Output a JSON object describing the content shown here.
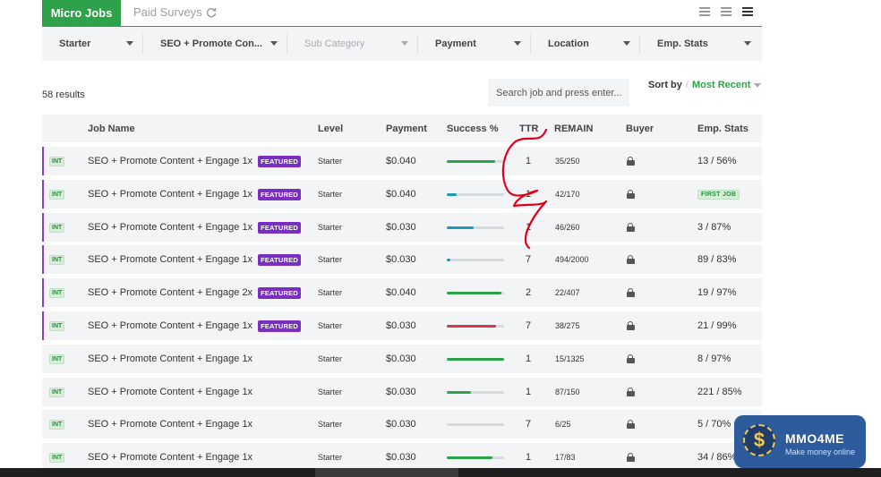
{
  "tabs": {
    "micro_jobs": "Micro Jobs",
    "paid_surveys": "Paid Surveys"
  },
  "filters": [
    {
      "label": "Starter",
      "muted": false
    },
    {
      "label": "SEO + Promote Con...",
      "muted": false
    },
    {
      "label": "Sub Category",
      "muted": true
    },
    {
      "label": "Payment",
      "muted": false
    },
    {
      "label": "Location",
      "muted": false
    },
    {
      "label": "Emp. Stats",
      "muted": false
    }
  ],
  "results_text": "58 results",
  "search": {
    "placeholder": "Search job and press enter..."
  },
  "sort": {
    "label": "Sort by",
    "value": "Most Recent"
  },
  "columns": {
    "job_name": "Job Name",
    "level": "Level",
    "payment": "Payment",
    "success": "Success %",
    "ttr": "TTR",
    "remain": "REMAIN",
    "buyer": "Buyer",
    "emp_stats": "Emp. Stats"
  },
  "tag_int": "INT",
  "tag_featured": "FEATURED",
  "tag_first_job": "FIRST JOB",
  "colors": {
    "green": "#2ea24a",
    "teal": "#1b9bb5",
    "red": "#d3384c",
    "purple": "#7a2fc2"
  },
  "jobs": [
    {
      "name": "SEO + Promote Content + Engage 1x",
      "featured": true,
      "level": "Starter",
      "payment": "$0.040",
      "success": 0.85,
      "bar_color": "green",
      "ttr": "1",
      "remain": "35/250",
      "emp": "13 / 56%"
    },
    {
      "name": "SEO + Promote Content + Engage 1x",
      "featured": true,
      "level": "Starter",
      "payment": "$0.040",
      "success": 0.17,
      "bar_color": "teal",
      "ttr": "1",
      "remain": "42/170",
      "emp": "",
      "first_job": true
    },
    {
      "name": "SEO + Promote Content + Engage 1x",
      "featured": true,
      "level": "Starter",
      "payment": "$0.030",
      "success": 0.47,
      "bar_color": "teal",
      "ttr": "1",
      "remain": "46/260",
      "emp": "3 / 87%"
    },
    {
      "name": "SEO + Promote Content + Engage 1x",
      "featured": true,
      "level": "Starter",
      "payment": "$0.030",
      "success": 0.06,
      "bar_color": "teal",
      "ttr": "7",
      "remain": "494/2000",
      "emp": "89 / 83%"
    },
    {
      "name": "SEO + Promote Content + Engage 2x",
      "featured": true,
      "level": "Starter",
      "payment": "$0.040",
      "success": 0.95,
      "bar_color": "green",
      "ttr": "2",
      "remain": "22/407",
      "emp": "19 / 97%"
    },
    {
      "name": "SEO + Promote Content + Engage 1x",
      "featured": true,
      "level": "Starter",
      "payment": "$0.030",
      "success": 0.86,
      "bar_color": "red",
      "ttr": "7",
      "remain": "38/275",
      "emp": "21 / 99%"
    },
    {
      "name": "SEO + Promote Content + Engage 1x",
      "featured": false,
      "level": "Starter",
      "payment": "$0.030",
      "success": 1.0,
      "bar_color": "green",
      "ttr": "1",
      "remain": "15/1325",
      "emp": "8 / 97%"
    },
    {
      "name": "SEO + Promote Content + Engage 1x",
      "featured": false,
      "level": "Starter",
      "payment": "$0.030",
      "success": 0.42,
      "bar_color": "green",
      "ttr": "1",
      "remain": "87/150",
      "emp": "221 / 85%"
    },
    {
      "name": "SEO + Promote Content + Engage 1x",
      "featured": false,
      "level": "Starter",
      "payment": "$0.030",
      "success": 0.0,
      "bar_color": "green",
      "ttr": "7",
      "remain": "6/25",
      "emp": "5 / 70%"
    },
    {
      "name": "SEO + Promote Content + Engage 1x",
      "featured": false,
      "level": "Starter",
      "payment": "$0.030",
      "success": 0.8,
      "bar_color": "green",
      "ttr": "1",
      "remain": "17/83",
      "emp": "34 / 86%"
    }
  ],
  "watermark": {
    "brand": "MMO4ME",
    "tagline": "Make money online"
  }
}
